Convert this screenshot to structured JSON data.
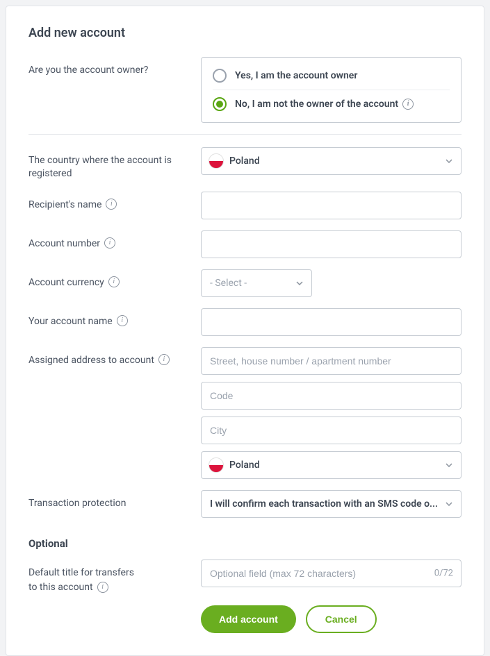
{
  "title": "Add new account",
  "owner": {
    "label": "Are you the account owner?",
    "opt_yes": "Yes, I am the account owner",
    "opt_no": "No, I am not the owner of the account",
    "selected": "no"
  },
  "country": {
    "label": "The country where the account is registered",
    "value": "Poland"
  },
  "recipient": {
    "label": "Recipient's name"
  },
  "account_number": {
    "label": "Account number"
  },
  "currency": {
    "label": "Account currency",
    "placeholder": "- Select -"
  },
  "your_name": {
    "label": "Your account name"
  },
  "address": {
    "label": "Assigned address to account",
    "street_ph": "Street, house number / apartment number",
    "code_ph": "Code",
    "city_ph": "City",
    "country_value": "Poland"
  },
  "protection": {
    "label": "Transaction protection",
    "value": "I will confirm each transaction with an SMS code o..."
  },
  "optional_head": "Optional",
  "default_title": {
    "label_line1": "Default title for transfers",
    "label_line2": "to this account",
    "placeholder": "Optional field (max 72 characters)",
    "counter": "0/72"
  },
  "buttons": {
    "add": "Add account",
    "cancel": "Cancel"
  }
}
